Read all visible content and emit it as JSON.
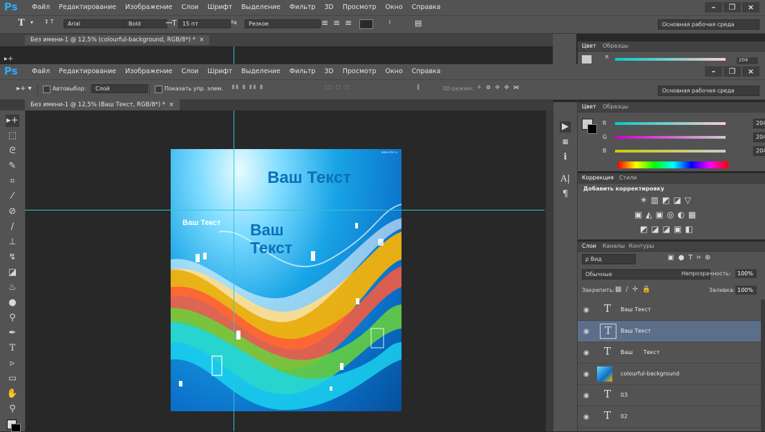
{
  "app": {
    "logo": "Ps"
  },
  "menu": [
    "Файл",
    "Редактирование",
    "Изображение",
    "Слои",
    "Шрифт",
    "Выделение",
    "Фильтр",
    "3D",
    "Просмотр",
    "Окно",
    "Справка"
  ],
  "back_window": {
    "options": {
      "tool_icon": "T",
      "font_family": "Arial",
      "font_style": "Bold",
      "font_size": "15 пт",
      "aa_label": "aa",
      "antialias": "Резкое",
      "workspace": "Основная рабочая среда"
    },
    "tab_title": "Без имени-1 @ 12,5% (colourful-background, RGB/8*) *",
    "panel_tabs": [
      "Цвет",
      "Образцы"
    ],
    "r_value": "204"
  },
  "front_window": {
    "options": {
      "autoselect_label": "Автовыбор:",
      "autoselect_value": "Слой",
      "show_transform_label": "Показать упр. элем.",
      "mode_3d_label": "3D-режим:",
      "workspace": "Основная рабочая среда"
    },
    "tab_title": "Без имени-1 @ 12,5% (Ваш Текст, RGB/8*) *"
  },
  "canvas": {
    "text_big": "Ваш Текст",
    "text_small": "Ваш Текст",
    "text_two_line_1": "Ваш",
    "text_two_line_2": "Текст",
    "corner_mark": "www.site.ru"
  },
  "color_panel": {
    "tabs": [
      "Цвет",
      "Образцы"
    ],
    "channels": [
      {
        "label": "R",
        "value": "204",
        "gradient": "linear-gradient(90deg,#00cccc,#ffcccc)"
      },
      {
        "label": "G",
        "value": "204",
        "gradient": "linear-gradient(90deg,#cc00cc,#cccccc)"
      },
      {
        "label": "B",
        "value": "204",
        "gradient": "linear-gradient(90deg,#cccc00,#cccccc)"
      }
    ]
  },
  "adjustments": {
    "tabs": [
      "Коррекция",
      "Стили"
    ],
    "title": "Добавить корректировку"
  },
  "layers_panel": {
    "tabs": [
      "Слои",
      "Каналы",
      "Контуры"
    ],
    "filter_label": "ρ Вид",
    "blend_mode": "Обычные",
    "opacity_label": "Непрозрачность:",
    "opacity_value": "100%",
    "lock_label": "Закрепить:",
    "fill_label": "Заливка:",
    "fill_value": "100%",
    "layers": [
      {
        "name": "Ваш Текст",
        "type": "text",
        "active": false
      },
      {
        "name": "Ваш Текст",
        "type": "text",
        "active": true
      },
      {
        "name": "Ваш      Текст",
        "type": "text",
        "active": false
      },
      {
        "name": "colourful-background",
        "type": "image",
        "active": false
      },
      {
        "name": "03",
        "type": "text",
        "active": false
      },
      {
        "name": "02",
        "type": "text",
        "active": false
      }
    ]
  },
  "colors": {
    "ps_blue": "#31a8ff",
    "ui_gray": "#535353",
    "canvas_text": "#0d6fb8",
    "guide": "#31c6d4",
    "active_layer": "#5c6f8a"
  }
}
